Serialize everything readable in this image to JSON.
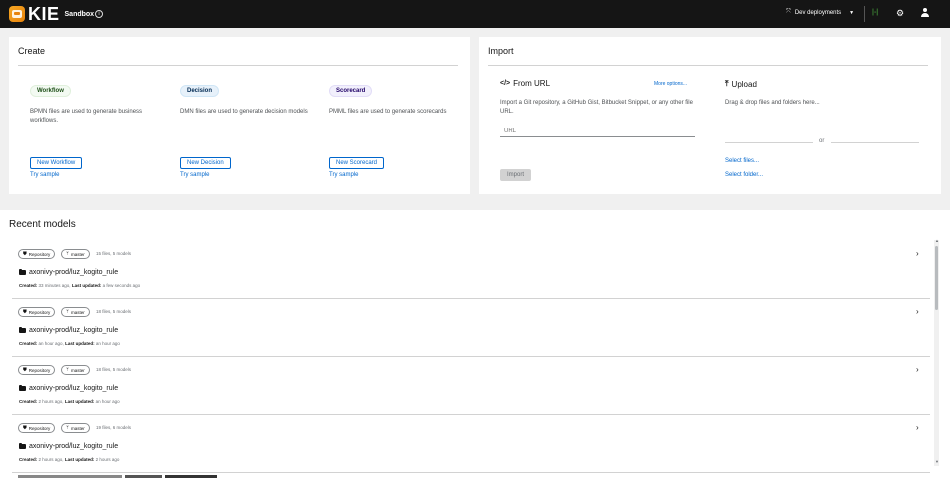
{
  "masthead": {
    "logo_text": "KIE",
    "logo_sub": "Sandbox",
    "info_glyph": "i",
    "dev_deployments_label": "Dev deployments",
    "dev_icon": "rocket-icon",
    "extension_icon": "plug-icon",
    "ext_glyph": "|-|"
  },
  "create": {
    "title": "Create",
    "columns": [
      {
        "badge": "Workflow",
        "description": "BPMN files are used to generate business workflows.",
        "button": "New Workflow",
        "sample": "Try sample",
        "color": "#3e8635"
      },
      {
        "badge": "Decision",
        "description": "DMN files are used to generate decision models",
        "button": "New Decision",
        "sample": "Try sample",
        "color": "#0066cc"
      },
      {
        "badge": "Scorecard",
        "description": "PMML files are used to generate scorecards",
        "button": "New Scorecard",
        "sample": "Try sample",
        "color": "#5752d1"
      }
    ]
  },
  "import": {
    "title": "Import",
    "from_url": {
      "title": "From URL",
      "more_options": "More options...",
      "description": "Import a Git repository, a GitHub Gist, Bitbucket Snippet, or any other file URL.",
      "placeholder": "URL",
      "button": "Import"
    },
    "upload": {
      "title": "Upload",
      "description": "Drag & drop files and folders here...",
      "or": "or",
      "select_files": "Select files...",
      "select_folder": "Select folder..."
    }
  },
  "recent": {
    "title": "Recent models",
    "chip_repository": "Repository",
    "chip_branch": "master",
    "created_label": "Created:",
    "updated_label": "Last updated:",
    "items": [
      {
        "files": "15 files, 5 models",
        "name": "axonivy-prod/luz_kogito_rule",
        "created": "33 minutes ago,",
        "updated": "a few seconds ago"
      },
      {
        "files": "18 files, 5 models",
        "name": "axonivy-prod/luz_kogito_rule",
        "created": "an hour ago,",
        "updated": "an hour ago"
      },
      {
        "files": "18 files, 5 models",
        "name": "axonivy-prod/luz_kogito_rule",
        "created": "2 hours ago,",
        "updated": "an hour ago"
      },
      {
        "files": "19 files, 6 models",
        "name": "axonivy-prod/luz_kogito_rule",
        "created": "2 hours ago,",
        "updated": "2 hours ago"
      }
    ]
  }
}
